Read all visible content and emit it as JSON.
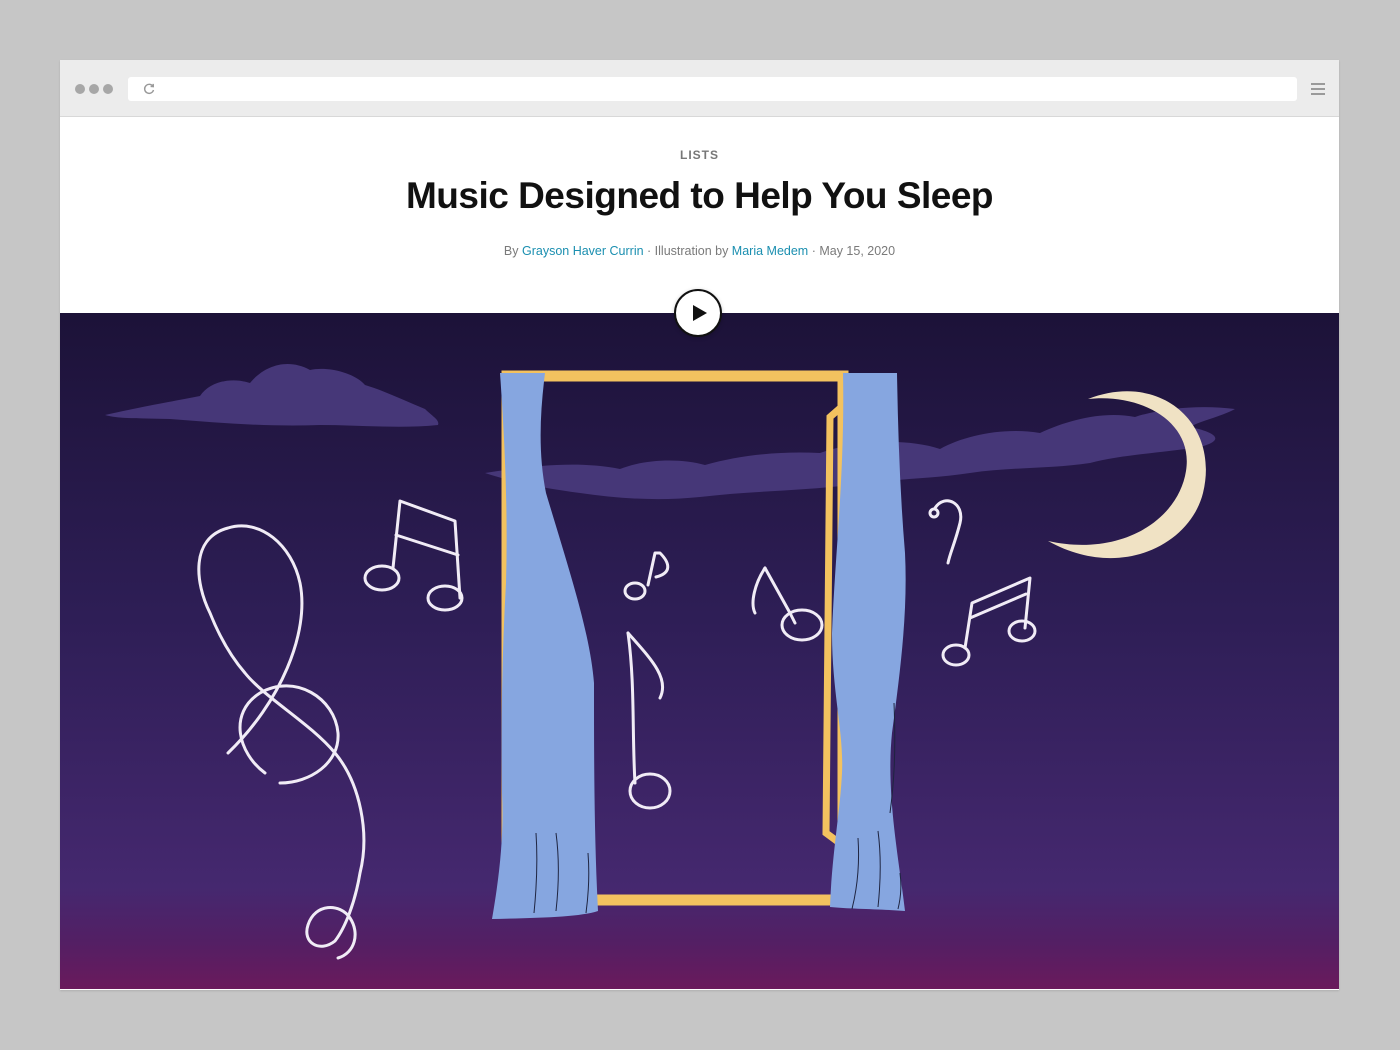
{
  "browser": {
    "url_value": "",
    "icons": {
      "window_dots": "traffic-dots",
      "reload": "reload-icon",
      "menu": "hamburger-menu-icon"
    }
  },
  "article": {
    "kicker": "LISTS",
    "title": "Music Designed to Help You Sleep",
    "byline": {
      "by_prefix": "By ",
      "author": "Grayson Haver Currin",
      "illustration_prefix": " · Illustration by ",
      "illustrator": "Maria Medem",
      "date_prefix": " · ",
      "date": "May 15, 2020"
    }
  },
  "hero": {
    "play_icon": "play-icon",
    "colors": {
      "sky_top": "#1c1238",
      "sky_mid": "#322058",
      "sky_bottom": "#4a2a78",
      "horizon": "#6a1a5c",
      "cloud": "#463778",
      "frame": "#f3c25f",
      "curtain": "#86a6e0",
      "moon": "#f0e2c4",
      "note_outline": "#f1ecf6"
    }
  },
  "theme": {
    "link_color": "#1b8fb0"
  }
}
